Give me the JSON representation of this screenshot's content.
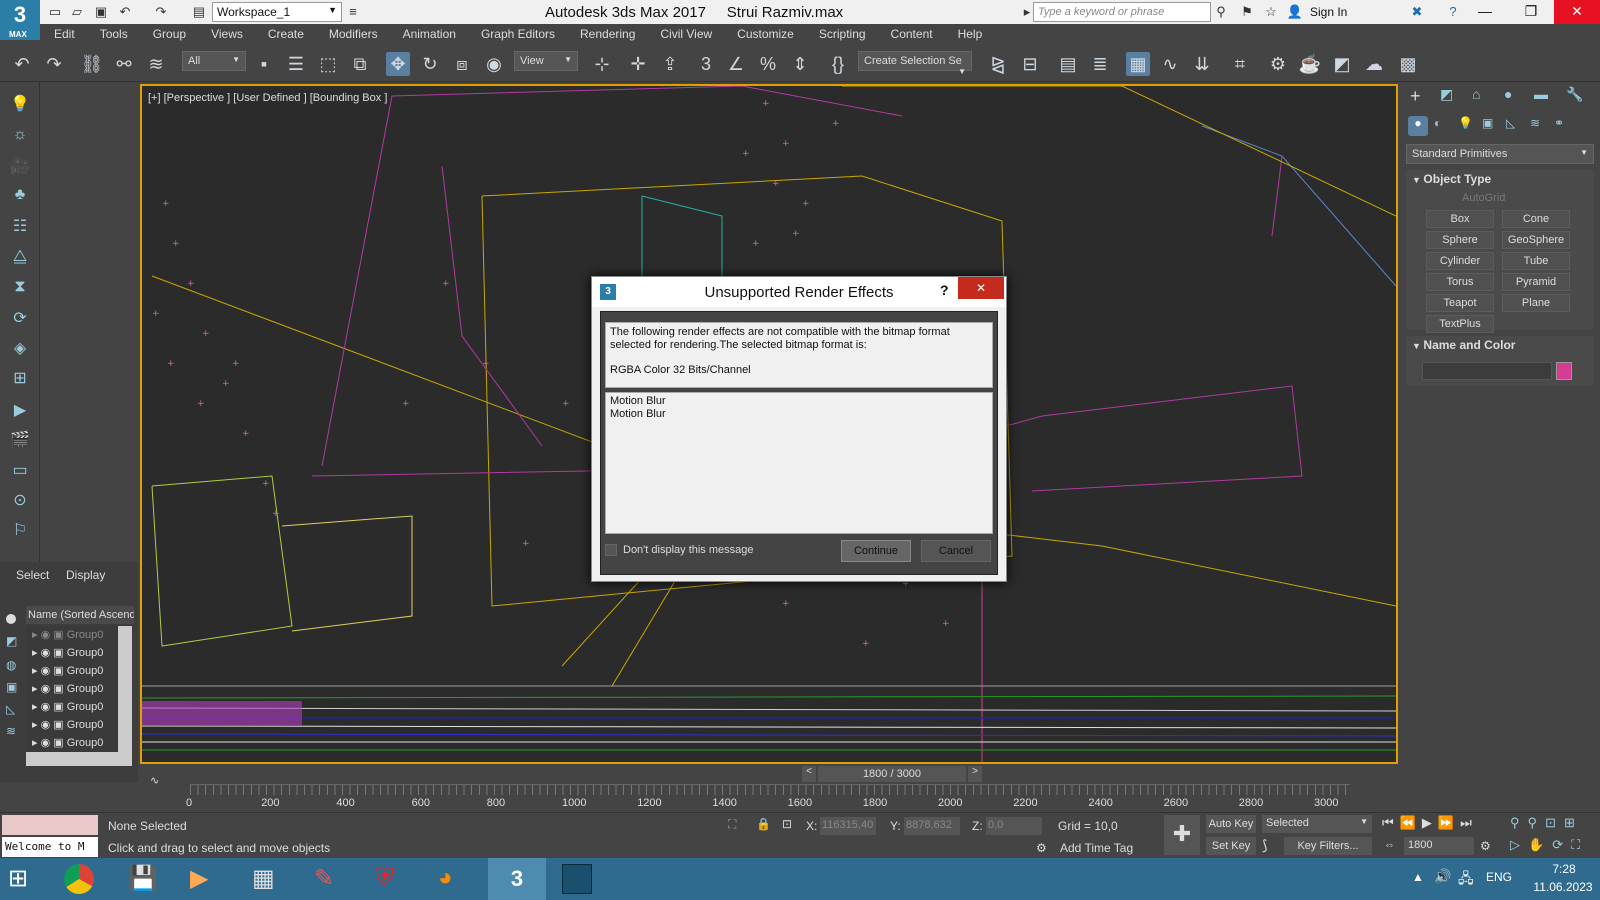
{
  "app": {
    "logo": "3",
    "logo_sub": "MAX",
    "title": "Autodesk 3ds Max 2017     Strui Razmiv.max",
    "workspace": "Workspace_1",
    "search_placeholder": "Type a keyword or phrase",
    "signin": "Sign In"
  },
  "menu": [
    "Edit",
    "Tools",
    "Group",
    "Views",
    "Create",
    "Modifiers",
    "Animation",
    "Graph Editors",
    "Rendering",
    "Civil View",
    "Customize",
    "Scripting",
    "Content",
    "Help"
  ],
  "toolbar": {
    "filter": "All",
    "refcoord": "View",
    "selection_set": "Create Selection Se"
  },
  "viewport": {
    "label": "[+] [Perspective ] [User Defined ] [Bounding Box ]"
  },
  "scene_explorer": {
    "tabs": [
      "Select",
      "Display"
    ],
    "column": "Name (Sorted Ascend",
    "rows": [
      "Group0",
      "Group0",
      "Group0",
      "Group0",
      "Group0",
      "Group0",
      "Group0"
    ]
  },
  "command_panel": {
    "category": "Standard Primitives",
    "object_type_title": "Object Type",
    "autogrid": "AutoGrid",
    "buttons": [
      "Box",
      "Cone",
      "Sphere",
      "GeoSphere",
      "Cylinder",
      "Tube",
      "Torus",
      "Pyramid",
      "Teapot",
      "Plane",
      "TextPlus"
    ],
    "name_color_title": "Name and Color",
    "color": "#d63a92"
  },
  "dialog": {
    "title": "Unsupported Render Effects",
    "help": "?",
    "close": "✕",
    "message": "The following render effects are not compatible with the bitmap format selected for rendering.The selected bitmap format is:",
    "format": "RGBA Color 32 Bits/Channel",
    "effects": [
      "Motion Blur",
      "Motion Blur"
    ],
    "checkbox": "Don't display this message",
    "continue": "Continue",
    "cancel": "Cancel"
  },
  "timeline": {
    "slider": "1800 / 3000",
    "ticks": [
      "0",
      "200",
      "400",
      "600",
      "800",
      "1000",
      "1200",
      "1400",
      "1600",
      "1800",
      "2000",
      "2200",
      "2400",
      "2600",
      "2800",
      "3000"
    ]
  },
  "status": {
    "maxscript": "Welcome to M",
    "selection": "None Selected",
    "prompt": "Click and drag to select and move objects",
    "x_label": "X:",
    "x": "116315,40",
    "y_label": "Y:",
    "y": "8878,632",
    "z_label": "Z:",
    "z": "0,0",
    "grid": "Grid = 10,0",
    "add_time_tag": "Add Time Tag",
    "auto_key": "Auto Key",
    "selected": "Selected",
    "set_key": "Set Key",
    "key_filters": "Key Filters...",
    "frame": "1800"
  },
  "taskbar": {
    "lang": "ENG",
    "time": "7:28",
    "date": "11.06.2023"
  }
}
